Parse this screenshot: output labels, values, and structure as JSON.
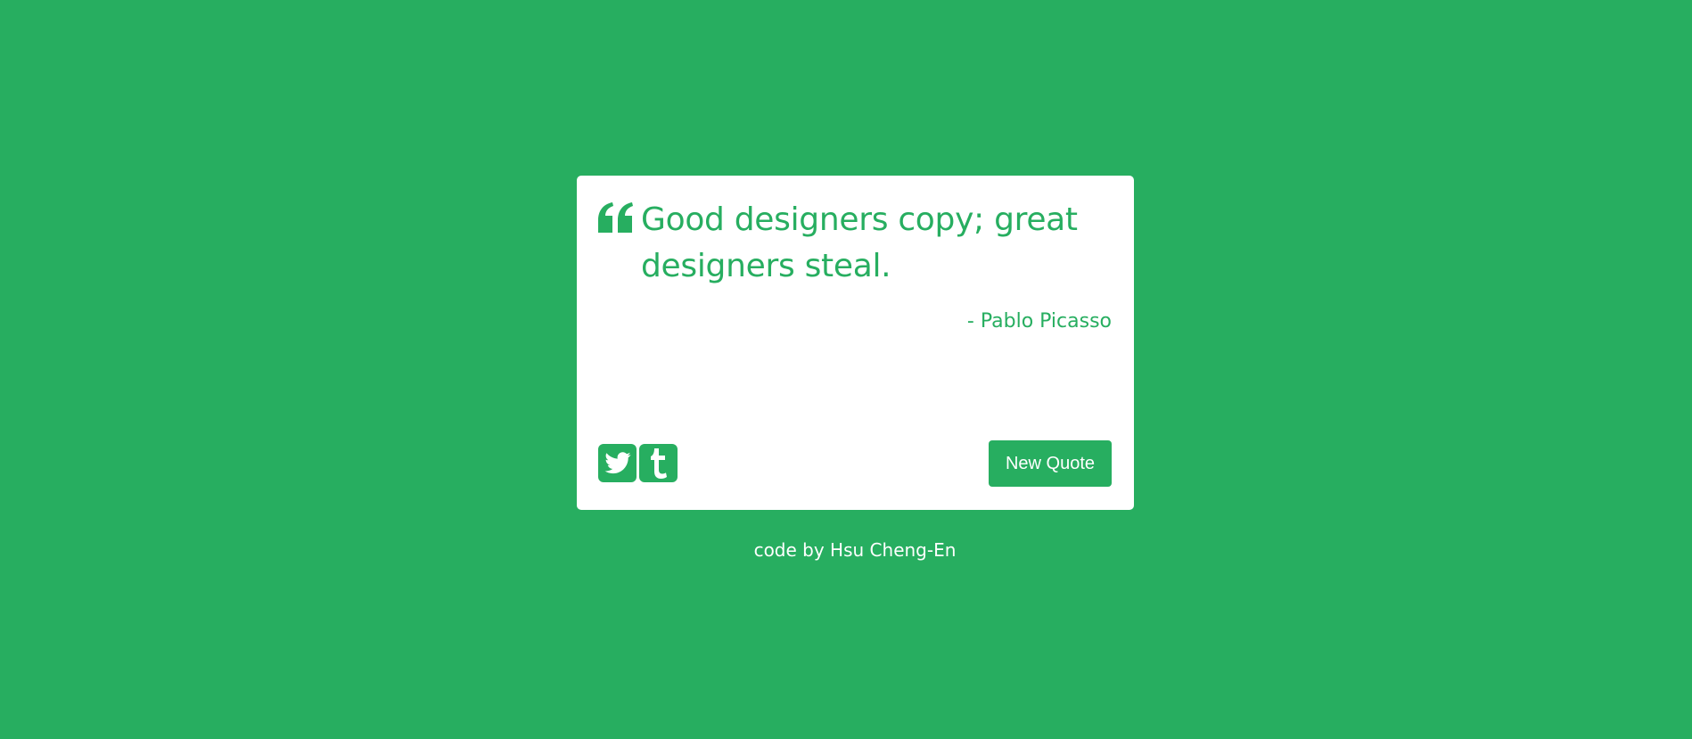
{
  "colors": {
    "background": "#27ae60",
    "card": "#ffffff",
    "accent": "#27ae60"
  },
  "quote": {
    "text": "Good designers copy; great designers steal.",
    "author": "- Pablo Picasso",
    "icon": "quote-left-icon"
  },
  "social": {
    "twitter_icon": "twitter-icon",
    "tumblr_icon": "tumblr-icon"
  },
  "actions": {
    "new_quote_label": "New Quote"
  },
  "footer": {
    "credit": "code by Hsu Cheng-En"
  }
}
